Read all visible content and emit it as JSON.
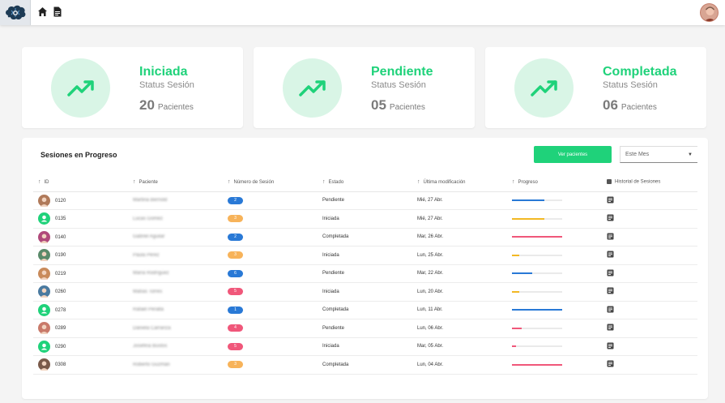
{
  "cards": [
    {
      "title": "Iniciada",
      "subtitle": "Status Sesión",
      "count": "20",
      "count_label": "Pacientes"
    },
    {
      "title": "Pendiente",
      "subtitle": "Status Sesión",
      "count": "05",
      "count_label": "Pacientes"
    },
    {
      "title": "Completada",
      "subtitle": "Status Sesión",
      "count": "06",
      "count_label": "Pacientes"
    }
  ],
  "panel": {
    "title": "Sesiones en Progreso",
    "view_button": "Ver pacientes",
    "filter_value": "Este Mes"
  },
  "columns": [
    "ID",
    "Paciente",
    "Número de Sesión",
    "Estado",
    "Última modificación",
    "Progreso",
    "Historial de Sesiones"
  ],
  "rows": [
    {
      "id": "0120",
      "name": "Martina Bernold",
      "session": "2",
      "status": "Pendiente",
      "modified": "Mié, 27 Abr.",
      "progress": 0.65,
      "color": "#2979d6",
      "avatar": "photo",
      "avatar_color": "#b07a5a"
    },
    {
      "id": "0135",
      "name": "Lucas Gomez",
      "session": "3",
      "status": "Iniciada",
      "modified": "Mié, 27 Abr.",
      "progress": 0.65,
      "color": "#f2b824",
      "avatar": "icon",
      "avatar_color": "#1fd27a"
    },
    {
      "id": "0140",
      "name": "Gabriel Aguilar",
      "session": "2",
      "status": "Completada",
      "modified": "Mar, 26 Abr.",
      "progress": 1.0,
      "color": "#f0577a",
      "avatar": "photo",
      "avatar_color": "#b0497a"
    },
    {
      "id": "0190",
      "name": "Paula Pérez",
      "session": "3",
      "status": "Iniciada",
      "modified": "Lun, 25 Abr.",
      "progress": 0.15,
      "color": "#f2b824",
      "avatar": "photo",
      "avatar_color": "#5a8a6a"
    },
    {
      "id": "0219",
      "name": "María Rodríguez",
      "session": "6",
      "status": "Pendiente",
      "modified": "Mar, 22 Abr.",
      "progress": 0.4,
      "color": "#2979d6",
      "avatar": "photo",
      "avatar_color": "#c98a5a"
    },
    {
      "id": "0260",
      "name": "Matías Torres",
      "session": "5",
      "status": "Iniciada",
      "modified": "Lun, 20 Abr.",
      "progress": 0.15,
      "color": "#f2b824",
      "avatar": "photo",
      "avatar_color": "#4a7aa0"
    },
    {
      "id": "0278",
      "name": "Rafael Peralta",
      "session": "1",
      "status": "Completada",
      "modified": "Lun, 11 Abr.",
      "progress": 1.0,
      "color": "#2979d6",
      "avatar": "icon",
      "avatar_color": "#1fd27a"
    },
    {
      "id": "0289",
      "name": "Daniela Carranza",
      "session": "4",
      "status": "Pendiente",
      "modified": "Lun, 06 Abr.",
      "progress": 0.2,
      "color": "#f0577a",
      "avatar": "photo",
      "avatar_color": "#c97a6a"
    },
    {
      "id": "0290",
      "name": "Josefina Bustos",
      "session": "5",
      "status": "Iniciada",
      "modified": "Mar, 05 Abr.",
      "progress": 0.08,
      "color": "#f0577a",
      "avatar": "icon",
      "avatar_color": "#1fd27a"
    },
    {
      "id": "0308",
      "name": "Roberto Guzmán",
      "session": "3",
      "status": "Completada",
      "modified": "Lun, 04 Abr.",
      "progress": 1.0,
      "color": "#f0577a",
      "avatar": "photo",
      "avatar_color": "#7a5a4a"
    }
  ],
  "session_pill_colors": {
    "1": "#2979d6",
    "2": "#2979d6",
    "3": "#f7b35a",
    "4": "#f0577a",
    "5": "#f0577a",
    "6": "#2979d6"
  },
  "colors": {
    "accent": "#1fd27a",
    "blue": "#2979d6",
    "yellow": "#f2b824",
    "red": "#f0577a"
  },
  "icons": {
    "logo": "brain-logo-icon",
    "home": "home-icon",
    "document": "document-icon",
    "history": "history-note-icon",
    "trend": "trending-up-icon",
    "sort": "arrow-up-icon",
    "dropdown": "caret-down-icon"
  }
}
